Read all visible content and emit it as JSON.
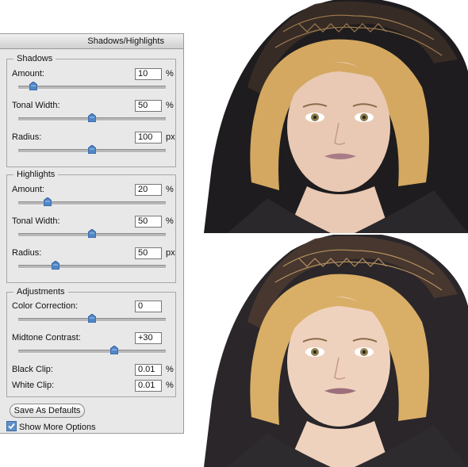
{
  "dialog": {
    "title": "Shadows/Highlights",
    "groups": {
      "shadows": {
        "title": "Shadows",
        "rows": [
          {
            "label": "Amount:",
            "value": "10",
            "unit": "%",
            "slider_fraction": 0.1
          },
          {
            "label": "Tonal Width:",
            "value": "50",
            "unit": "%",
            "slider_fraction": 0.5
          },
          {
            "label": "Radius:",
            "value": "100",
            "unit": "px",
            "slider_fraction": 0.5
          }
        ]
      },
      "highlights": {
        "title": "Highlights",
        "rows": [
          {
            "label": "Amount:",
            "value": "20",
            "unit": "%",
            "slider_fraction": 0.2
          },
          {
            "label": "Tonal Width:",
            "value": "50",
            "unit": "%",
            "slider_fraction": 0.5
          },
          {
            "label": "Radius:",
            "value": "50",
            "unit": "px",
            "slider_fraction": 0.25
          }
        ]
      },
      "adjustments": {
        "title": "Adjustments",
        "rows": [
          {
            "label": "Color Correction:",
            "value": "0",
            "unit": "",
            "slider_fraction": 0.5
          },
          {
            "label": "Midtone Contrast:",
            "value": "+30",
            "unit": "",
            "slider_fraction": 0.65
          },
          {
            "label": "Black Clip:",
            "value": "0.01",
            "unit": "%"
          },
          {
            "label": "White Clip:",
            "value": "0.01",
            "unit": "%"
          }
        ]
      }
    },
    "save_defaults_label": "Save As Defaults",
    "show_more_options": {
      "label": "Show More Options",
      "checked": true
    }
  },
  "photos": {
    "before_description_colors": {
      "hood": "#1e1c1e",
      "hair": "#d4a860",
      "skin": "#e9c9b3"
    },
    "after_description_colors": {
      "hood": "#2a262a",
      "hair": "#d9ae66",
      "skin": "#efd2bd"
    }
  }
}
